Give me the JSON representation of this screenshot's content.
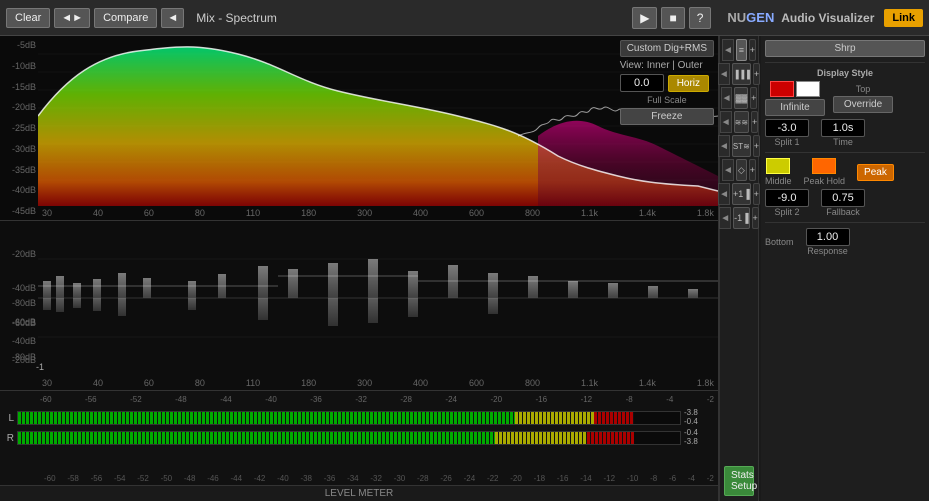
{
  "header": {
    "clear_label": "Clear",
    "compare_label": "Compare",
    "title": "Mix - Spectrum",
    "play_icon": "▶",
    "stop_icon": "■",
    "question_icon": "?",
    "logo_nu": "NU",
    "logo_gen": "GEN",
    "logo_suffix": " Audio Visualizer",
    "link_label": "Link"
  },
  "spectrum": {
    "db_labels": [
      "-5dB",
      "-10dB",
      "-15dB",
      "-20dB",
      "-25dB",
      "-30dB",
      "-35dB",
      "-40dB",
      "-45dB"
    ],
    "freq_labels": [
      "30",
      "40",
      "60",
      "80",
      "110",
      "180",
      "300",
      "400",
      "600",
      "800",
      "1.1k",
      "1.4k",
      "1.8k"
    ],
    "custom_dig_rms": "Custom Dig+RMS",
    "view_label": "View: Inner | Outer",
    "full_scale_value": "0.0",
    "horiz_label": "Horiz",
    "full_scale_label": "Full Scale",
    "freeze_label": "Freeze"
  },
  "analyzer": {
    "db_labels": [
      "-20dB",
      "-40dB",
      "-60dB",
      "-80dB"
    ],
    "db_labels_bottom": [
      "-80dB",
      "-60dB",
      "-40dB",
      "-20dB"
    ],
    "freq_labels": [
      "30",
      "40",
      "60",
      "80",
      "110",
      "180",
      "300",
      "400",
      "600",
      "800",
      "1.1k",
      "1.4k",
      "1.8k"
    ],
    "marker_value": "-1"
  },
  "controls": {
    "shrp_label": "Shrp",
    "display_style_label": "Display Style",
    "top_label": "Top",
    "infinite_label": "Infinite",
    "override_label": "Override",
    "split1_value": "-3.0",
    "split1_label": "Split 1",
    "time_value": "1.0s",
    "time_label": "Time",
    "middle_label": "Middle",
    "peak_hold_label": "Peak Hold",
    "peak_label": "Peak",
    "split2_value": "-9.0",
    "split2_label": "Split 2",
    "fallback_value": "0.75",
    "fallback_label": "Fallback",
    "bottom_label": "Bottom",
    "response_value": "1.00",
    "response_label": "Response"
  },
  "level_meter": {
    "title": "LEVEL METER",
    "scale_labels": [
      "-60",
      "-58",
      "-56",
      "-54",
      "-52",
      "-50",
      "-48",
      "-46",
      "-44",
      "-42",
      "-40",
      "-38",
      "-36",
      "-34",
      "-32",
      "-30",
      "-28",
      "-26",
      "-24",
      "-22",
      "-20",
      "-18",
      "-16",
      "-14",
      "-12",
      "-10",
      "-8",
      "-6",
      "-4",
      "-2"
    ],
    "channels": [
      "L",
      "R"
    ],
    "right_labels": [
      "-3.8",
      "-0.4",
      "-0.4",
      "-3.8"
    ]
  },
  "side_buttons": {
    "btn1_icon": "≡",
    "btn2_icon": "▐▐",
    "btn3_icon": "▓",
    "btn4_icon": "≋",
    "btn5_icon": "ST",
    "btn6_icon": "◇",
    "btn7_icon": "+1",
    "btn8_icon": "-1",
    "plus_icon": "+",
    "minus_icon": "−",
    "arrow_left": "◄"
  }
}
